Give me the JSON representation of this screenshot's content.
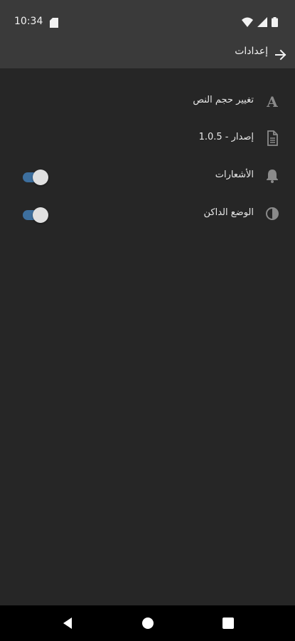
{
  "status_bar": {
    "time": "10:34",
    "icons": [
      "sd-card-icon",
      "wifi-icon",
      "signal-icon",
      "battery-icon"
    ]
  },
  "app_bar": {
    "title": "إعدادات",
    "back_icon": "arrow-right-icon"
  },
  "settings": {
    "items": [
      {
        "label": "تغيير حجم النص",
        "icon": "font-size-icon"
      },
      {
        "label": "إصدار - 1.0.5",
        "icon": "document-icon"
      },
      {
        "label": "الأشعارات",
        "icon": "bell-icon",
        "toggle_on": true
      },
      {
        "label": "الوضع الداكن",
        "icon": "contrast-icon",
        "toggle_on": true
      }
    ]
  },
  "navigation": {
    "buttons": [
      "back-triangle-icon",
      "home-circle-icon",
      "recents-square-icon"
    ]
  },
  "colors": {
    "background": "#262626",
    "app_bar": "#3a3a3a",
    "toggle_track": "#3d6f9e",
    "toggle_thumb": "#e0e0e0"
  }
}
